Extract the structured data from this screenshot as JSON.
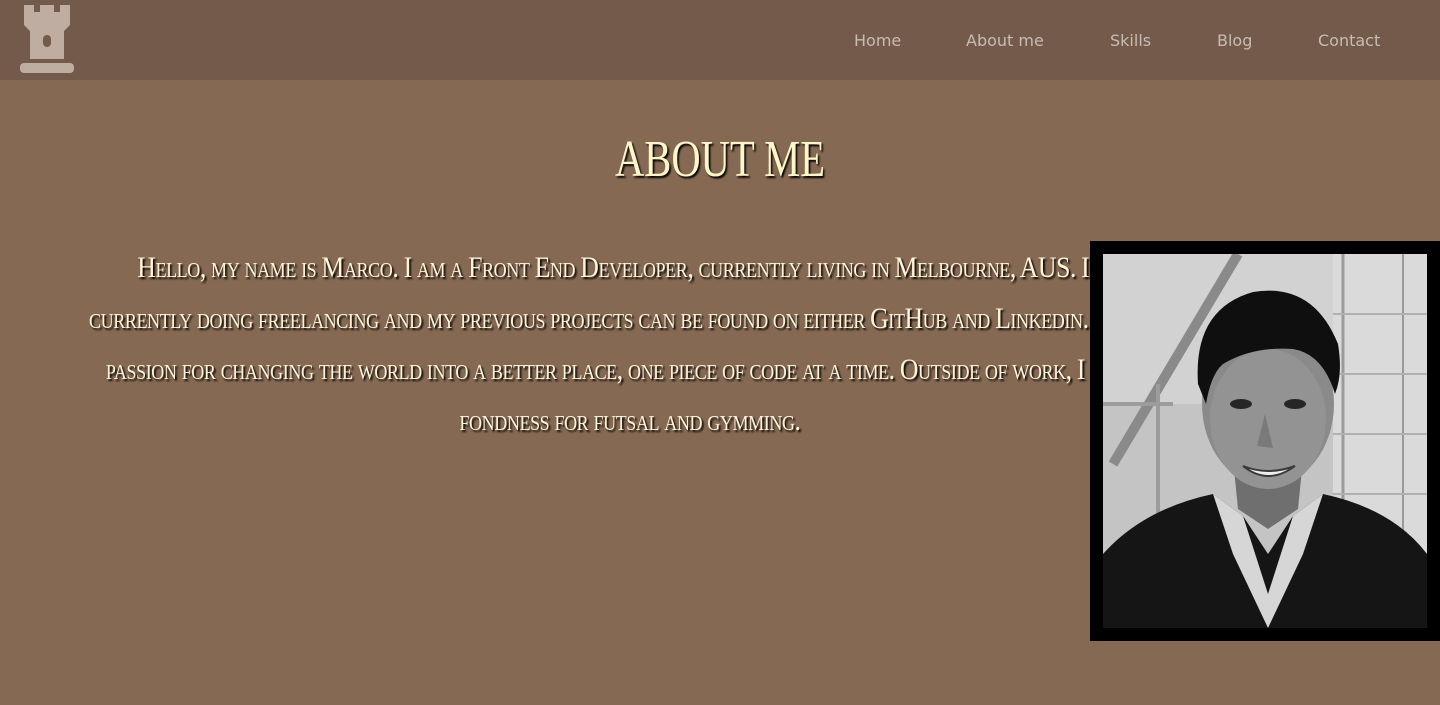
{
  "nav": {
    "logo_icon": "castle-rook-icon",
    "links": [
      {
        "label": "Home"
      },
      {
        "label": "About me"
      },
      {
        "label": "Skills"
      },
      {
        "label": "Blog"
      },
      {
        "label": "Contact"
      }
    ]
  },
  "main": {
    "heading": "ABOUT ME",
    "bio": "Hello, my name is Marco. I am a Front End Developer, currently living in Melbourne, AUS. I am currently doing freelancing and my previous projects can be found on either GitHub and Linkedin. I have a passion for changing the world into a better place, one piece of code at a time. Outside of work, I have a fondness for futsal and gymming."
  },
  "colors": {
    "page_background": "#856953",
    "navbar_background": "#735a4a",
    "nav_link": "#c9bcb2",
    "heading": "#fdf6c8",
    "photo_frame": "#000000"
  }
}
